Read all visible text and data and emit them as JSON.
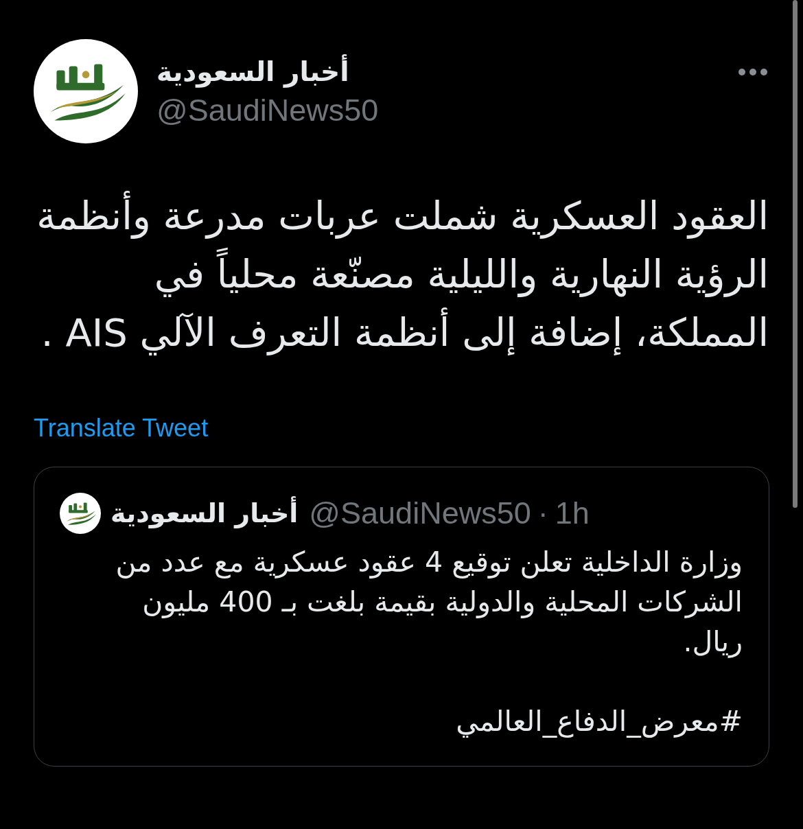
{
  "tweet": {
    "author": {
      "name": "أخبار السعودية",
      "handle": "@SaudiNews50"
    },
    "text": "العقود العسكرية شملت عربات مدرعة وأنظمة الرؤية النهارية والليلية مصنّعة محلياً في المملكة، إضافة إلى أنظمة التعرف الآلي AIS .",
    "translate_link": "Translate Tweet",
    "quoted_tweet": {
      "author": {
        "name": "أخبار السعودية",
        "handle": "@SaudiNews50"
      },
      "separator": "·",
      "time": "1h",
      "text": "وزارة الداخلية تعلن توقيع 4 عقود عسكرية مع عدد من الشركات المحلية والدولية بقيمة بلغت بـ 400 مليون ريال.",
      "hashtag": "#معرض_الدفاع_العالمي"
    }
  }
}
